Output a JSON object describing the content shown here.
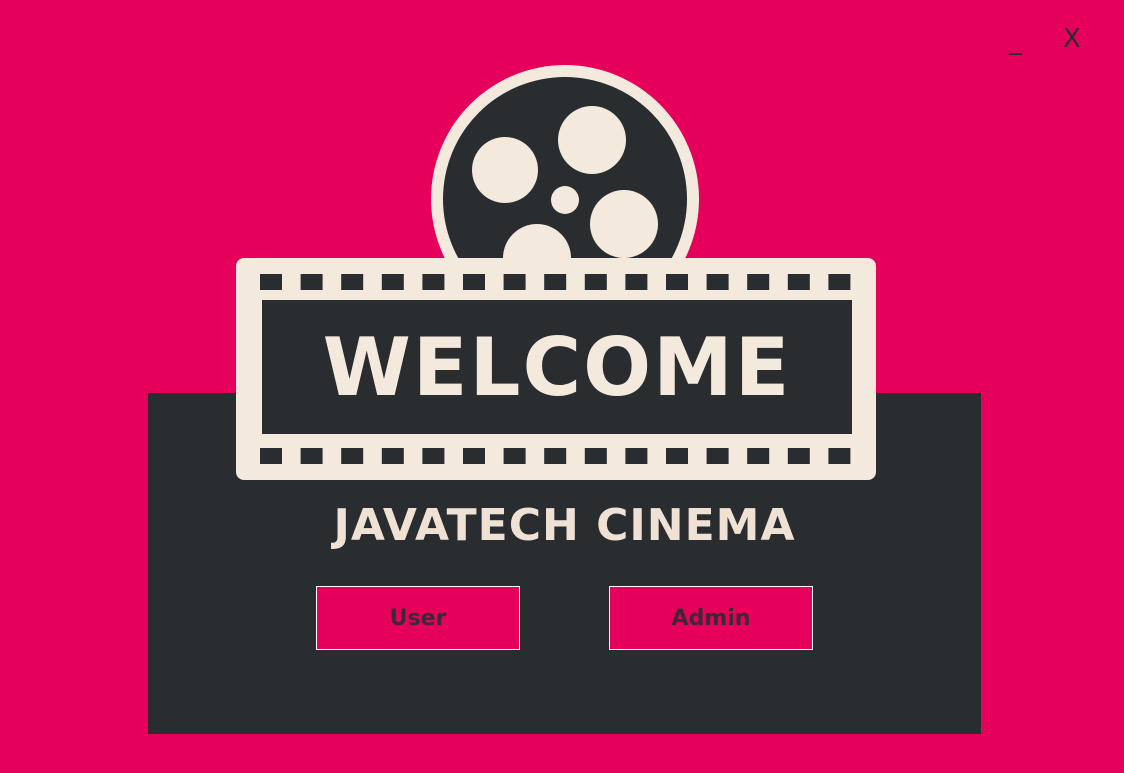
{
  "window": {
    "minimize_label": "_",
    "close_label": "X"
  },
  "logo": {
    "welcome": "WELCOME",
    "icon": "film-reel-icon"
  },
  "subtitle": "JAVATECH CINEMA",
  "buttons": {
    "user": "User",
    "admin": "Admin"
  },
  "colors": {
    "background": "#e5005b",
    "panel": "#292d30",
    "cream": "#f3e9dd"
  }
}
